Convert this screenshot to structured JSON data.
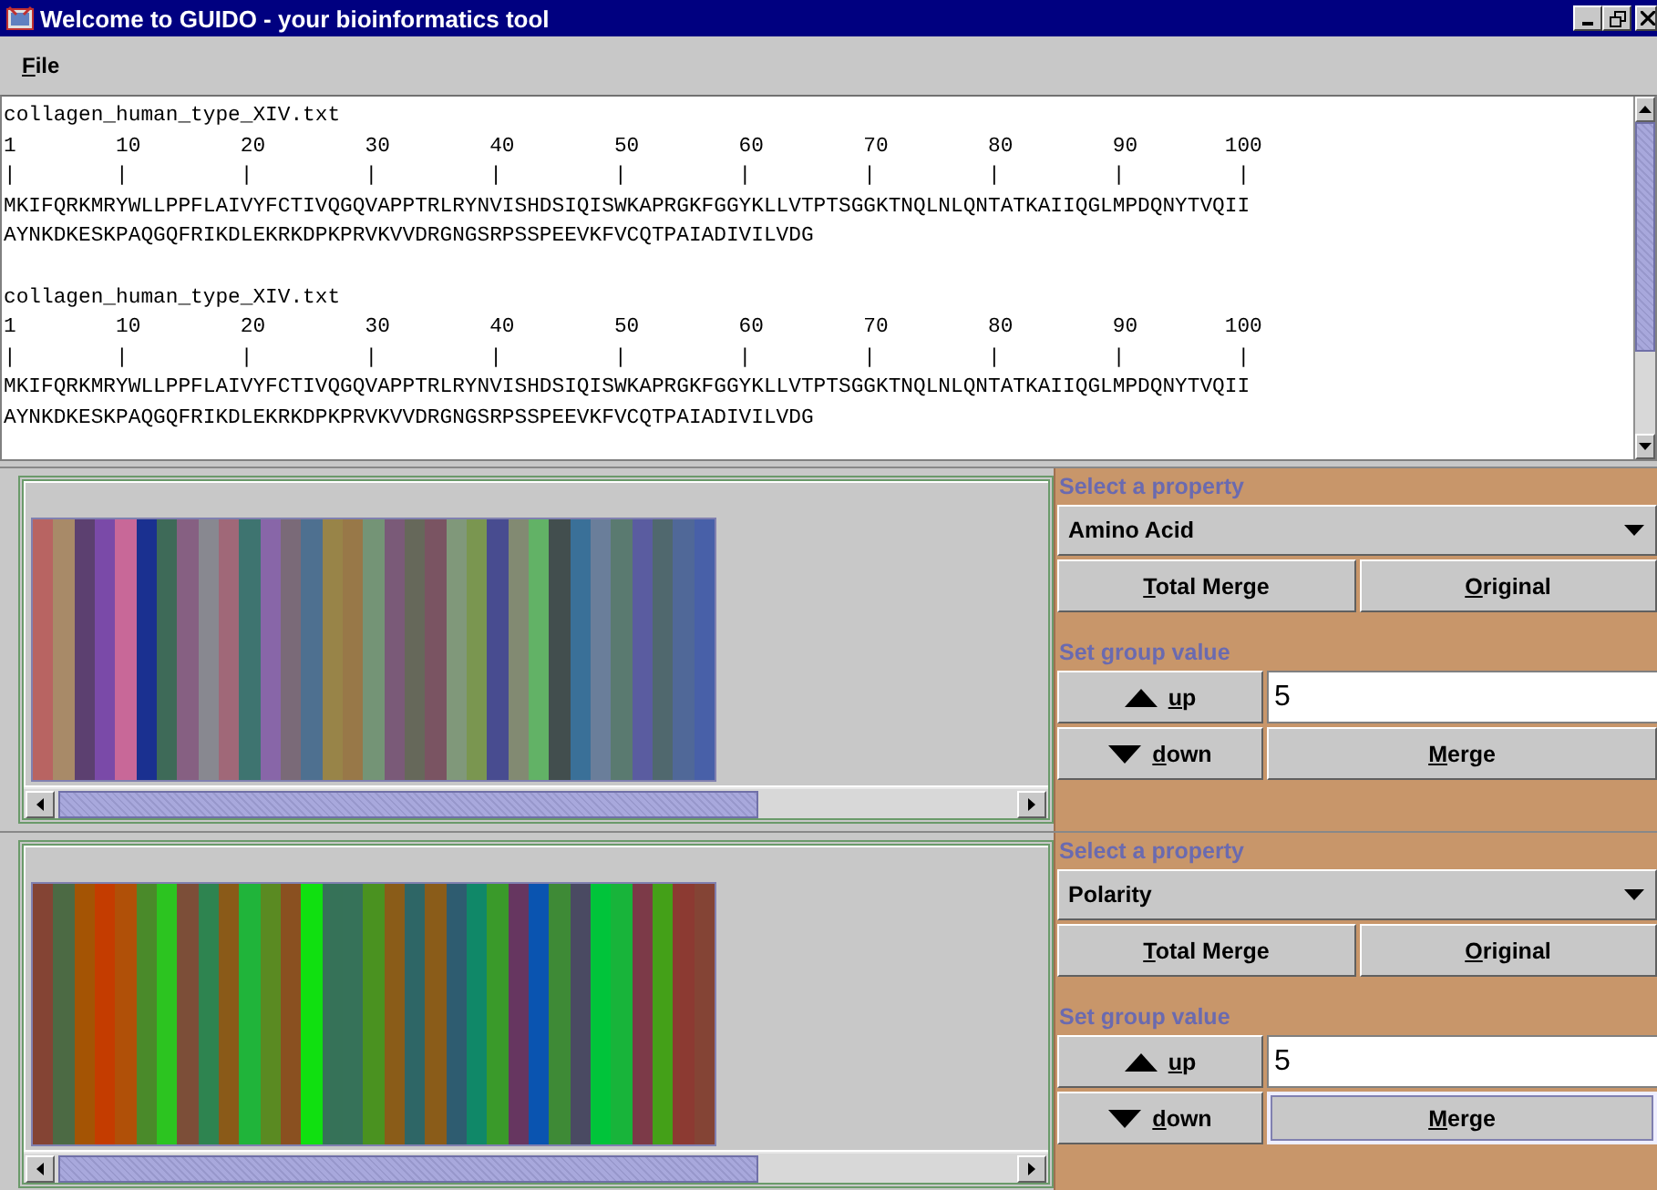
{
  "window": {
    "title": "Welcome to GUIDO - your bioinformatics tool"
  },
  "menu": [
    "File"
  ],
  "sequence_view": {
    "blocks": [
      {
        "filename": "collagen_human_type_XIV.txt",
        "ruler": "1        10        20        30        40        50        60        70        80        90       100",
        "ticks": "|        |         |         |         |         |         |         |         |         |         |",
        "lines": [
          "MKIFQRKMRYWLLPPFLAIVYFCTIVQGQVAPPTRLRYNVISHDSIQISWKAPRGKFGGYKLLVTPTSGGKTNQLNLQNTATKAIIQGLMPDQNYTVQII",
          "AYNKDKESKPAQGQFRIKDLEKRKDPKPRVKVVDRGNGSRPSSPEEVKFVCQTPAIADIVILVDG"
        ]
      },
      {
        "filename": "collagen_human_type_XIV.txt",
        "ruler": "1        10        20        30        40        50        60        70        80        90       100",
        "ticks": "|        |         |         |         |         |         |         |         |         |         |",
        "lines": [
          "MKIFQRKMRYWLLPPFLAIVYFCTIVQGQVAPPTRLRYNVISHDSIQISWKAPRGKFGGYKLLVTPTSGGKTNQLNLQNTATKAIIQGLMPDQNYTVQII",
          "AYNKDKESKPAQGQFRIKDLEKRKDPKPRVKVVDRGNGSRPSSPEEVKFVCQTPAIADIVILVDG"
        ]
      }
    ]
  },
  "panels": [
    {
      "bars": [
        {
          "color": "#b86462"
        },
        {
          "color": "#a88a68"
        },
        {
          "color": "#5c4070"
        },
        {
          "color": "#7a4aa8"
        },
        {
          "color": "#c86898"
        },
        {
          "color": "#1a3090"
        },
        {
          "color": "#3e6a58"
        },
        {
          "color": "#866082"
        },
        {
          "color": "#888890"
        },
        {
          "color": "#a06878"
        },
        {
          "color": "#3e7470"
        },
        {
          "color": "#8866a8"
        },
        {
          "color": "#7a6a78"
        },
        {
          "color": "#4e7090"
        },
        {
          "color": "#988448"
        },
        {
          "color": "#987848"
        },
        {
          "color": "#749476"
        },
        {
          "color": "#7a5a78"
        },
        {
          "color": "#66685a"
        },
        {
          "color": "#7a5462"
        },
        {
          "color": "#80987a"
        },
        {
          "color": "#7a9650"
        },
        {
          "color": "#484c90"
        },
        {
          "color": "#828a72"
        },
        {
          "color": "#62b266"
        },
        {
          "color": "#424e4e"
        },
        {
          "color": "#3a7098"
        },
        {
          "color": "#6a7e9a"
        },
        {
          "color": "#5a7a70"
        },
        {
          "color": "#5a5ca0"
        },
        {
          "color": "#50686e"
        },
        {
          "color": "#506898"
        },
        {
          "color": "#4860a8"
        }
      ],
      "property_label": "Select a property",
      "property": "Amino Acid",
      "total_merge": "Total Merge",
      "original": "Original",
      "group_label": "Set group value",
      "up": "up",
      "down": "down",
      "group_value": "5",
      "merge": {
        "label": "Merge",
        "focused": false
      }
    },
    {
      "bars": [
        {
          "color": "#844434"
        },
        {
          "color": "#4c6a44"
        },
        {
          "color": "#a45404"
        },
        {
          "color": "#c43c00"
        },
        {
          "color": "#b05008"
        },
        {
          "color": "#4a8a2a"
        },
        {
          "color": "#2cc420"
        },
        {
          "color": "#7c4e38"
        },
        {
          "color": "#2e8450"
        },
        {
          "color": "#8a5a18"
        },
        {
          "color": "#20b43a"
        },
        {
          "color": "#5a8a22"
        },
        {
          "color": "#8a5020"
        },
        {
          "color": "#10e010"
        },
        {
          "color": "#367258"
        },
        {
          "color": "#367259"
        },
        {
          "color": "#4a9220"
        },
        {
          "color": "#8a5c18"
        },
        {
          "color": "#2e6666"
        },
        {
          "color": "#8a5c19"
        },
        {
          "color": "#2e5c70"
        },
        {
          "color": "#108868"
        },
        {
          "color": "#3a9a2a"
        },
        {
          "color": "#663660"
        },
        {
          "color": "#0a54b0"
        },
        {
          "color": "#3e8a36"
        },
        {
          "color": "#4a4a62"
        },
        {
          "color": "#00c43a"
        },
        {
          "color": "#18b43a"
        },
        {
          "color": "#7c3a48"
        },
        {
          "color": "#44a018"
        },
        {
          "color": "#8c3a32"
        },
        {
          "color": "#844435"
        }
      ],
      "property_label": "Select a property",
      "property": "Polarity",
      "total_merge": "Total Merge",
      "original": "Original",
      "group_label": "Set group value",
      "up": "up",
      "down": "down",
      "group_value": "5",
      "merge": {
        "label": "Merge",
        "focused": true
      }
    }
  ]
}
